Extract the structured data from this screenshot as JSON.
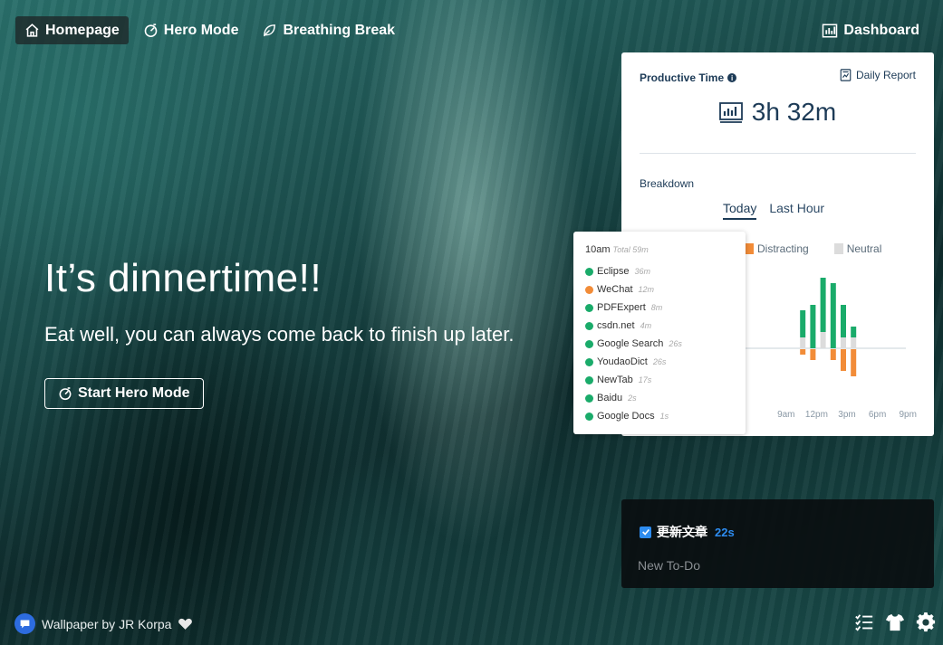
{
  "nav": {
    "items": [
      {
        "label": "Homepage",
        "icon": "home-icon",
        "active": true
      },
      {
        "label": "Hero Mode",
        "icon": "timer-icon",
        "active": false
      },
      {
        "label": "Breathing Break",
        "icon": "leaf-icon",
        "active": false
      }
    ],
    "dashboard_label": "Dashboard"
  },
  "hero": {
    "title": "It’s dinnertime!!",
    "subtitle": "Eat well, you can always come back to finish up later.",
    "button_label": "Start Hero Mode"
  },
  "stats": {
    "productive_time_label": "Productive Time",
    "daily_report_label": "Daily Report",
    "productive_time_value": "3h 32m",
    "breakdown_label": "Breakdown",
    "tabs": [
      "Today",
      "Last Hour"
    ],
    "active_tab": "Today",
    "legend": [
      {
        "label": "Distracting",
        "color": "#f28c38"
      },
      {
        "label": "Neutral",
        "color": "#dcdcdc"
      }
    ]
  },
  "chart_data": {
    "type": "bar",
    "x_tick_labels": [
      "9am",
      "12pm",
      "3pm",
      "6pm",
      "9pm"
    ],
    "colors": {
      "productive": "#1aab6a",
      "distracting": "#f28c38",
      "neutral": "#dcdcdc"
    },
    "series": [
      {
        "name": "Productive",
        "values": [
          0,
          0,
          0,
          0,
          0,
          0,
          5,
          8,
          10,
          12,
          6,
          2,
          0,
          0,
          0,
          0,
          0,
          0,
          0,
          0,
          1,
          0,
          0,
          0
        ]
      },
      {
        "name": "Neutral",
        "values": [
          0,
          0,
          0,
          0,
          0,
          0,
          2,
          0,
          3,
          0,
          2,
          2,
          0,
          0,
          0,
          0,
          0,
          0,
          0,
          0,
          0.5,
          0,
          0,
          0
        ]
      },
      {
        "name": "Distracting",
        "values": [
          0,
          0,
          0,
          0,
          0,
          0,
          1,
          2,
          0,
          2,
          4,
          5,
          0,
          0,
          0,
          0,
          0,
          0,
          0,
          0,
          2,
          0,
          0,
          0
        ]
      }
    ]
  },
  "tooltip": {
    "hour": "10am",
    "total": "Total 59m",
    "rows": [
      {
        "name": "Eclipse",
        "dur": "36m",
        "color": "#1aab6a"
      },
      {
        "name": "WeChat",
        "dur": "12m",
        "color": "#f28c38"
      },
      {
        "name": "PDFExpert",
        "dur": "8m",
        "color": "#1aab6a"
      },
      {
        "name": "csdn.net",
        "dur": "4m",
        "color": "#1aab6a"
      },
      {
        "name": "Google Search",
        "dur": "26s",
        "color": "#1aab6a"
      },
      {
        "name": "YoudaoDict",
        "dur": "26s",
        "color": "#1aab6a"
      },
      {
        "name": "NewTab",
        "dur": "17s",
        "color": "#1aab6a"
      },
      {
        "name": "Baidu",
        "dur": "2s",
        "color": "#1aab6a"
      },
      {
        "name": "Google Docs",
        "dur": "1s",
        "color": "#1aab6a"
      }
    ]
  },
  "todo": {
    "item_text": "更新文章",
    "item_time": "22s",
    "new_placeholder": "New To-Do"
  },
  "footer": {
    "credit": "Wallpaper by JR Korpa"
  }
}
